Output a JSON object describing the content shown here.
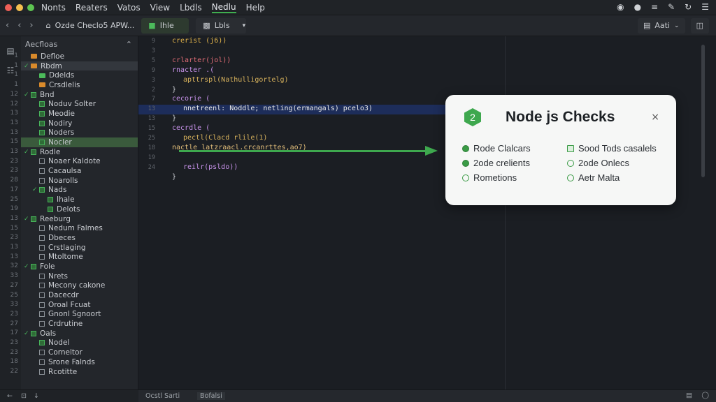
{
  "menubar": {
    "items": [
      "Nonts",
      "Reaters",
      "Vatos",
      "View",
      "Lbdls",
      "Nedlu",
      "Help"
    ],
    "active_index": 5
  },
  "toolbar": {
    "file_label": "Ozde Checlo5 APW...",
    "tab1": "Ihle",
    "tab2": "Lbls",
    "right_button": "Aati"
  },
  "sidebar": {
    "header": "Aecfloas",
    "rows": [
      {
        "text": "Defloe",
        "kind": "folder-orange",
        "indent": 0
      },
      {
        "text": "Rbdm",
        "kind": "caret-folder",
        "indent": 0,
        "highlight": true
      },
      {
        "text": "Ddelds",
        "kind": "folder-green",
        "indent": 1
      },
      {
        "text": "Crsdlelis",
        "kind": "folder-orange",
        "indent": 1
      },
      {
        "text": "Bnd",
        "kind": "caret-check",
        "indent": 0
      },
      {
        "text": "Noduv Solter",
        "kind": "check-on",
        "indent": 1
      },
      {
        "text": "Meodie",
        "kind": "check-on",
        "indent": 1
      },
      {
        "text": "Nodiry",
        "kind": "check-on",
        "indent": 1
      },
      {
        "text": "Noders",
        "kind": "check-on",
        "indent": 1
      },
      {
        "text": "Nocler",
        "kind": "check-on",
        "indent": 1,
        "selected": true
      },
      {
        "text": "Rodle",
        "kind": "caret-check",
        "indent": 0
      },
      {
        "text": "Noaer Kaldote",
        "kind": "check-off",
        "indent": 1
      },
      {
        "text": "Cacaulsa",
        "kind": "check-off",
        "indent": 1
      },
      {
        "text": "Noarolls",
        "kind": "check-off",
        "indent": 1
      },
      {
        "text": "Nads",
        "kind": "caret-check",
        "indent": 1
      },
      {
        "text": "Ihale",
        "kind": "check-on",
        "indent": 2
      },
      {
        "text": "Delots",
        "kind": "check-on",
        "indent": 2
      },
      {
        "text": "Reeburg",
        "kind": "caret-check",
        "indent": 0
      },
      {
        "text": "Nedum Falmes",
        "kind": "check-off",
        "indent": 1
      },
      {
        "text": "Dbeces",
        "kind": "check-off",
        "indent": 1
      },
      {
        "text": "Crstlaging",
        "kind": "check-off",
        "indent": 1
      },
      {
        "text": "Mtoltome",
        "kind": "check-off",
        "indent": 1
      },
      {
        "text": "Fole",
        "kind": "caret-check",
        "indent": 0
      },
      {
        "text": "Nrets",
        "kind": "check-off",
        "indent": 1
      },
      {
        "text": "Mecony cakone",
        "kind": "check-off",
        "indent": 1
      },
      {
        "text": "Dacecdr",
        "kind": "check-off",
        "indent": 1
      },
      {
        "text": "Oroal Fcuat",
        "kind": "check-off",
        "indent": 1
      },
      {
        "text": "Gnonl Sgnoort",
        "kind": "check-off",
        "indent": 1
      },
      {
        "text": "Crdrutine",
        "kind": "check-off",
        "indent": 1
      },
      {
        "text": "Oals",
        "kind": "caret-check",
        "indent": 0
      },
      {
        "text": "Nodel",
        "kind": "check-on",
        "indent": 1
      },
      {
        "text": "Corneltor",
        "kind": "check-off",
        "indent": 1
      },
      {
        "text": "Srone Falnds",
        "kind": "check-off",
        "indent": 1
      },
      {
        "text": "Rcotitte",
        "kind": "check-off",
        "indent": 1
      }
    ],
    "line_numbers": [
      "1",
      "1",
      "1",
      "1",
      "12",
      "12",
      "13",
      "13",
      "13",
      "15",
      "13",
      "23",
      "23",
      "28",
      "17",
      "25",
      "19",
      "13",
      "15",
      "23",
      "13",
      "13",
      "32",
      "33",
      "27",
      "25",
      "33",
      "23",
      "27",
      "17",
      "23",
      "23",
      "18",
      "22"
    ]
  },
  "editor": {
    "lines": [
      {
        "num": "9",
        "text": "crerist (j6))",
        "color": "#e0b24a",
        "indent": 0
      },
      {
        "num": "3",
        "text": "",
        "color": "#c9ccd1",
        "indent": 0
      },
      {
        "num": "5",
        "text": "crlarter(jol))",
        "color": "#e06c75",
        "indent": 0
      },
      {
        "num": "9",
        "text": "rnacter .(",
        "color": "#c792ea",
        "indent": 0
      },
      {
        "num": "3",
        "text": "apttrspl(Nathulligortelg)",
        "color": "#d6b15c",
        "indent": 1
      },
      {
        "num": "2",
        "text": "}",
        "color": "#c9ccd1",
        "indent": 0
      },
      {
        "num": "7",
        "text": "cecorie (",
        "color": "#c792ea",
        "indent": 0
      },
      {
        "num": "13",
        "text": "nnetreenl: Noddle; netling(ermangals) pcelo3)",
        "color": "#e8e8e8",
        "indent": 1
      },
      {
        "num": "13",
        "text": "}",
        "color": "#c9ccd1",
        "indent": 0
      },
      {
        "num": "15",
        "text": "cecrdle (",
        "color": "#c792ea",
        "indent": 0
      },
      {
        "num": "25",
        "text": "pectl(Clacd rlile(1)",
        "color": "#d6b15c",
        "indent": 1
      },
      {
        "num": "18",
        "text": "nactle latzraacl.crcanrttes,ao7)",
        "color": "#e5c07b",
        "indent": 0
      },
      {
        "num": "19",
        "text": "",
        "color": "#c9ccd1",
        "indent": 0
      },
      {
        "num": "24",
        "text": "reilr(psldo))",
        "color": "#c792ea",
        "indent": 1
      },
      {
        "num": "",
        "text": "}",
        "color": "#c9ccd1",
        "indent": 0
      }
    ],
    "highlight_index": 7
  },
  "popup": {
    "badge": "2",
    "title": "Node js Checks",
    "close": "×",
    "left_items": [
      {
        "label": "Rode Clalcars",
        "icon": "fill"
      },
      {
        "label": "2ode crelients",
        "icon": "fill"
      },
      {
        "label": "Rometions",
        "icon": "ring"
      }
    ],
    "right_items": [
      {
        "label": "Sood Tods casalels",
        "icon": "sq"
      },
      {
        "label": "2ode Onlecs",
        "icon": "ring"
      },
      {
        "label": "Aetr Malta",
        "icon": "ring"
      }
    ]
  },
  "statusbar": {
    "left": "Ocstl Sarti",
    "right": "Bofalsi"
  },
  "colors": {
    "accent": "#3ea84e",
    "highlight_line": "#1d2d5a",
    "selected_row": "#3a5a3c"
  }
}
